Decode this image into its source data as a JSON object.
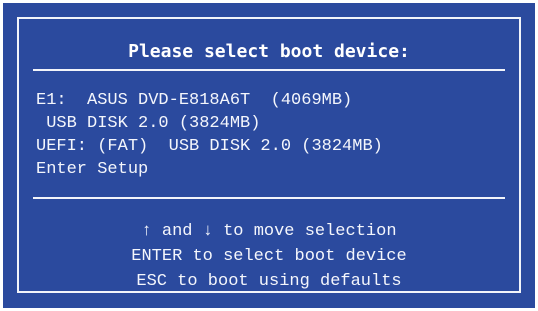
{
  "title": "Please select boot device:",
  "boot_devices": [
    {
      "label": "E1:  ASUS DVD-E818A6T  (4069MB)"
    },
    {
      "label": " USB DISK 2.0 (3824MB)"
    },
    {
      "label": "UEFI: (FAT)  USB DISK 2.0 (3824MB)"
    },
    {
      "label": "Enter Setup"
    }
  ],
  "help": {
    "arrow_up": "↑",
    "and_text": " and ",
    "arrow_down": "↓",
    "move_text": " to move selection",
    "enter_line": "ENTER to select boot device",
    "esc_line": "ESC to boot using defaults"
  },
  "colors": {
    "background": "#2b4a9e",
    "text": "#f4f6fc",
    "border": "#f2f4fa"
  }
}
